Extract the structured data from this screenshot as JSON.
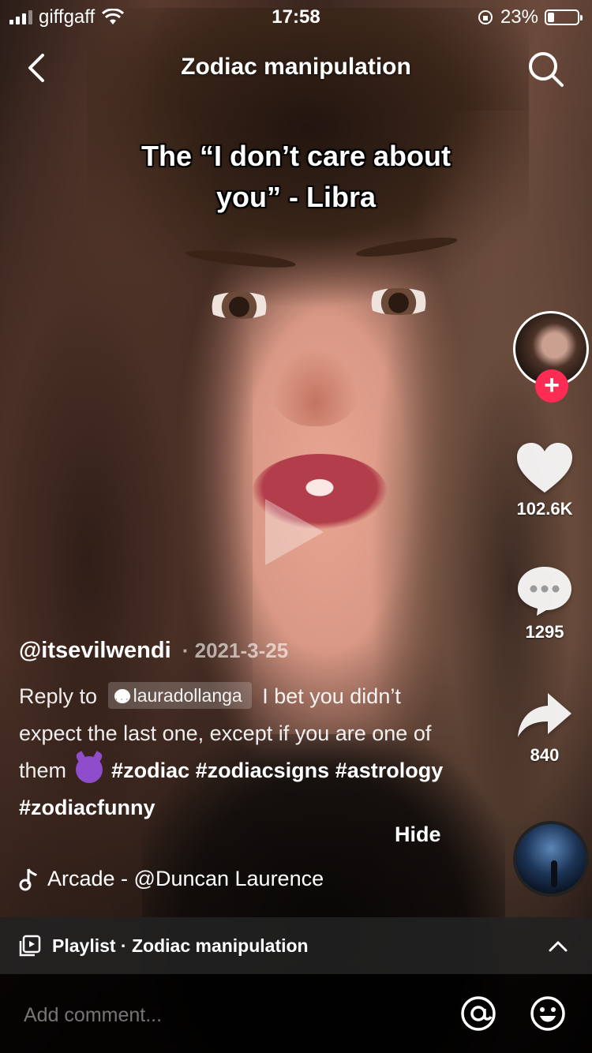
{
  "status_bar": {
    "carrier": "giffgaff",
    "time": "17:58",
    "battery_percent": "23%",
    "battery_level": 0.23
  },
  "header": {
    "title": "Zodiac manipulation"
  },
  "video": {
    "caption": "The “I don’t care about you” - Libra"
  },
  "rail": {
    "likes": "102.6K",
    "comments": "1295",
    "shares": "840"
  },
  "post": {
    "author": "@itsevilwendi",
    "date": "· 2021-3-25",
    "reply_to_label": "Reply to",
    "reply_to_user": "lauradollanga",
    "text_part1": " I bet you didn’t expect the last one, except if you are one of them",
    "hashtags": [
      "#zodiac",
      "#zodiacsigns",
      "#astrology",
      "#zodiacfunny"
    ],
    "hide_label": "Hide"
  },
  "music": {
    "label": "Arcade - @Duncan Laurence"
  },
  "playlist": {
    "label": "Playlist · Zodiac manipulation"
  },
  "comment_bar": {
    "placeholder": "Add comment..."
  },
  "colors": {
    "follow_accent": "#fe2c55"
  },
  "icons": {
    "back": "chevron-left-icon",
    "search": "search-icon",
    "like": "heart-icon",
    "comment": "comment-bubble-icon",
    "share": "share-arrow-icon",
    "music": "music-note-icon",
    "playlist": "playlist-icon",
    "expand": "chevron-up-icon",
    "mention": "at-sign-icon",
    "emoji": "smiley-icon",
    "play": "play-icon"
  }
}
